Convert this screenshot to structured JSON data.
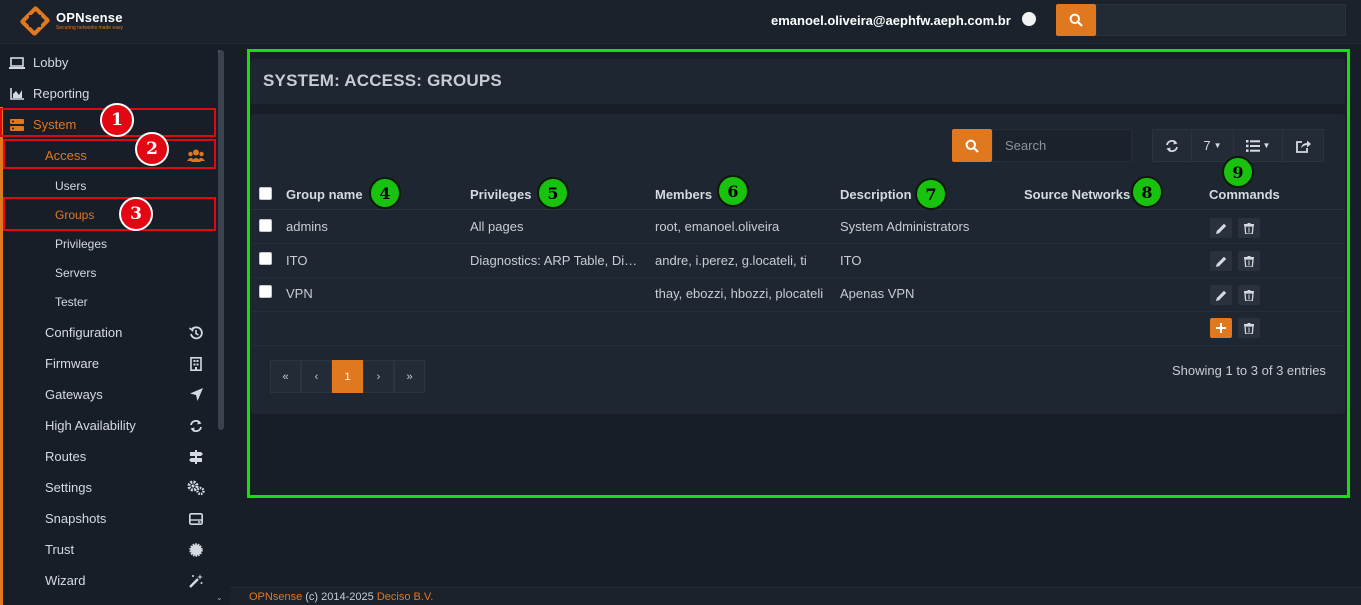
{
  "topbar": {
    "brand_name": "OPNsense",
    "brand_tagline": "Securing networks made easy",
    "user_email": "emanoel.oliveira@aephfw.aeph.com.br",
    "accent_color": "#e0781f"
  },
  "sidebar": {
    "items": [
      {
        "label": "Lobby",
        "icon": "laptop-icon"
      },
      {
        "label": "Reporting",
        "icon": "area-chart-icon"
      },
      {
        "label": "System",
        "icon": "server-icon"
      },
      {
        "label": "Access",
        "icon": "users-icon"
      },
      {
        "label": "Users"
      },
      {
        "label": "Groups"
      },
      {
        "label": "Privileges"
      },
      {
        "label": "Servers"
      },
      {
        "label": "Tester"
      },
      {
        "label": "Configuration",
        "icon": "history-icon"
      },
      {
        "label": "Firmware",
        "icon": "building-icon"
      },
      {
        "label": "Gateways",
        "icon": "location-arrow-icon"
      },
      {
        "label": "High Availability",
        "icon": "refresh-icon"
      },
      {
        "label": "Routes",
        "icon": "signpost-icon"
      },
      {
        "label": "Settings",
        "icon": "cogs-icon"
      },
      {
        "label": "Snapshots",
        "icon": "hdd-icon"
      },
      {
        "label": "Trust",
        "icon": "certificate-icon"
      },
      {
        "label": "Wizard",
        "icon": "magic-icon"
      }
    ]
  },
  "main": {
    "title": "SYSTEM: ACCESS: GROUPS",
    "search_placeholder": "Search",
    "rows_per_page": "7",
    "columns": [
      "Group name",
      "Privileges",
      "Members",
      "Description",
      "Source Networks",
      "Commands"
    ],
    "rows": [
      {
        "name": "admins",
        "privileges": "All pages",
        "members": "root, emanoel.oliveira",
        "description": "System Administrators",
        "source_networks": ""
      },
      {
        "name": "ITO",
        "privileges": "Diagnostics: ARP Table, Diagnostics: Authentication",
        "members": "andre, i.perez, g.locateli, ti",
        "description": "ITO",
        "source_networks": ""
      },
      {
        "name": "VPN",
        "privileges": "",
        "members": "thay, ebozzi, hbozzi, plocateli",
        "description": "Apenas VPN",
        "source_networks": ""
      }
    ],
    "pager": [
      "«",
      "‹",
      "1",
      "›",
      "»"
    ],
    "entries_text": "Showing 1 to 3 of 3 entries"
  },
  "annotations": {
    "red": [
      "1",
      "2",
      "3"
    ],
    "green": [
      "4",
      "5",
      "6",
      "7",
      "8",
      "9"
    ],
    "red_color": "#e30613",
    "green_color": "#19c20f"
  },
  "footer": {
    "brand": "OPNsense",
    "copyright": "(c) 2014-2025",
    "company": "Deciso B.V."
  }
}
